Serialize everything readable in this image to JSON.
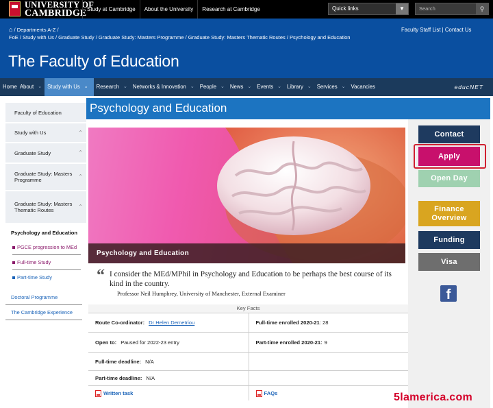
{
  "brand": {
    "line1": "UNIVERSITY OF",
    "line2": "CAMBRIDGE"
  },
  "top_links": [
    "Study at Cambridge",
    "About the University",
    "Research at Cambridge"
  ],
  "quick_links": {
    "label": "Quick links",
    "arrow": "▼"
  },
  "search": {
    "placeholder": "Search",
    "icon": "search-icon"
  },
  "breadcrumb": {
    "line1": "/ Departments A-Z /",
    "line2": "FoE / Study with Us / Graduate Study / Graduate Study: Masters Programme / Graduate Study: Masters Thematic Routes / Psychology and Education"
  },
  "staff_links": {
    "staff": "Faculty Staff List",
    "sep": "|",
    "contact": "Contact Us"
  },
  "faculty_title": "The Faculty of Education",
  "nav": {
    "items": [
      "Home",
      "About",
      "Study with Us",
      "Research",
      "Networks & Innovation",
      "People",
      "News",
      "Events",
      "Library",
      "Services",
      "Vacancies"
    ],
    "active_index": 2,
    "educnet": "educNET"
  },
  "sidebar": {
    "items": [
      "Faculty of Education",
      "Study with Us",
      "Graduate Study",
      "Graduate Study: Masters Programme",
      "Graduate Study: Masters Thematic Routes"
    ],
    "current": "Psychology and Education",
    "children": [
      {
        "label": "PGCE progression to MEd",
        "color": "#8b1a6b"
      },
      {
        "label": "Full-time Study",
        "color": "#8b1a6b"
      },
      {
        "label": "Part-time Study",
        "color": "#1a63b8"
      }
    ],
    "links": [
      "Doctoral Programme",
      "The Cambridge Experience"
    ]
  },
  "page_title": "Psychology and Education",
  "hero_caption": "Psychology and Education",
  "quote": {
    "mark": "“",
    "text": "I consider the MEd/MPhil in Psychology and Education to be perhaps the best course of its kind in the country.",
    "attribution": "Professor Neil Humphrey, University of Manchester, External Examiner"
  },
  "key_facts": {
    "heading": "Key Facts",
    "route_label": "Route Co-ordinator:",
    "route_value": "Dr Helen Demetriou",
    "ft_enrolled_label": "Full-time enrolled 2020-21",
    "ft_enrolled_value": ": 28",
    "open_label": "Open to:",
    "open_value": "Paused for 2022-23 entry",
    "pt_enrolled_label": "Part-time enrolled 2020-21:",
    "pt_enrolled_value": "9",
    "ft_deadline_label": "Full-time deadline:",
    "ft_deadline_value": "N/A",
    "pt_deadline_label": "Part-time deadline:",
    "pt_deadline_value": "N/A",
    "written_task": "Written task",
    "faqs": "FAQs"
  },
  "right_buttons": {
    "contact": "Contact",
    "apply": "Apply",
    "open_day": "Open Day",
    "finance": "Finance Overview",
    "funding": "Funding",
    "visa": "Visa",
    "facebook": "f"
  },
  "colors": {
    "header_blue": "#0a4fa0",
    "nav_dark": "#1b3a5c",
    "banner_blue": "#1c74c1",
    "contact": "#1e3a5f",
    "apply": "#c8106c",
    "open_day": "#9fd1b0",
    "finance": "#d9a520",
    "funding": "#1e3a5f",
    "visa": "#6e6e6e"
  },
  "watermark": "5lamerica.com"
}
